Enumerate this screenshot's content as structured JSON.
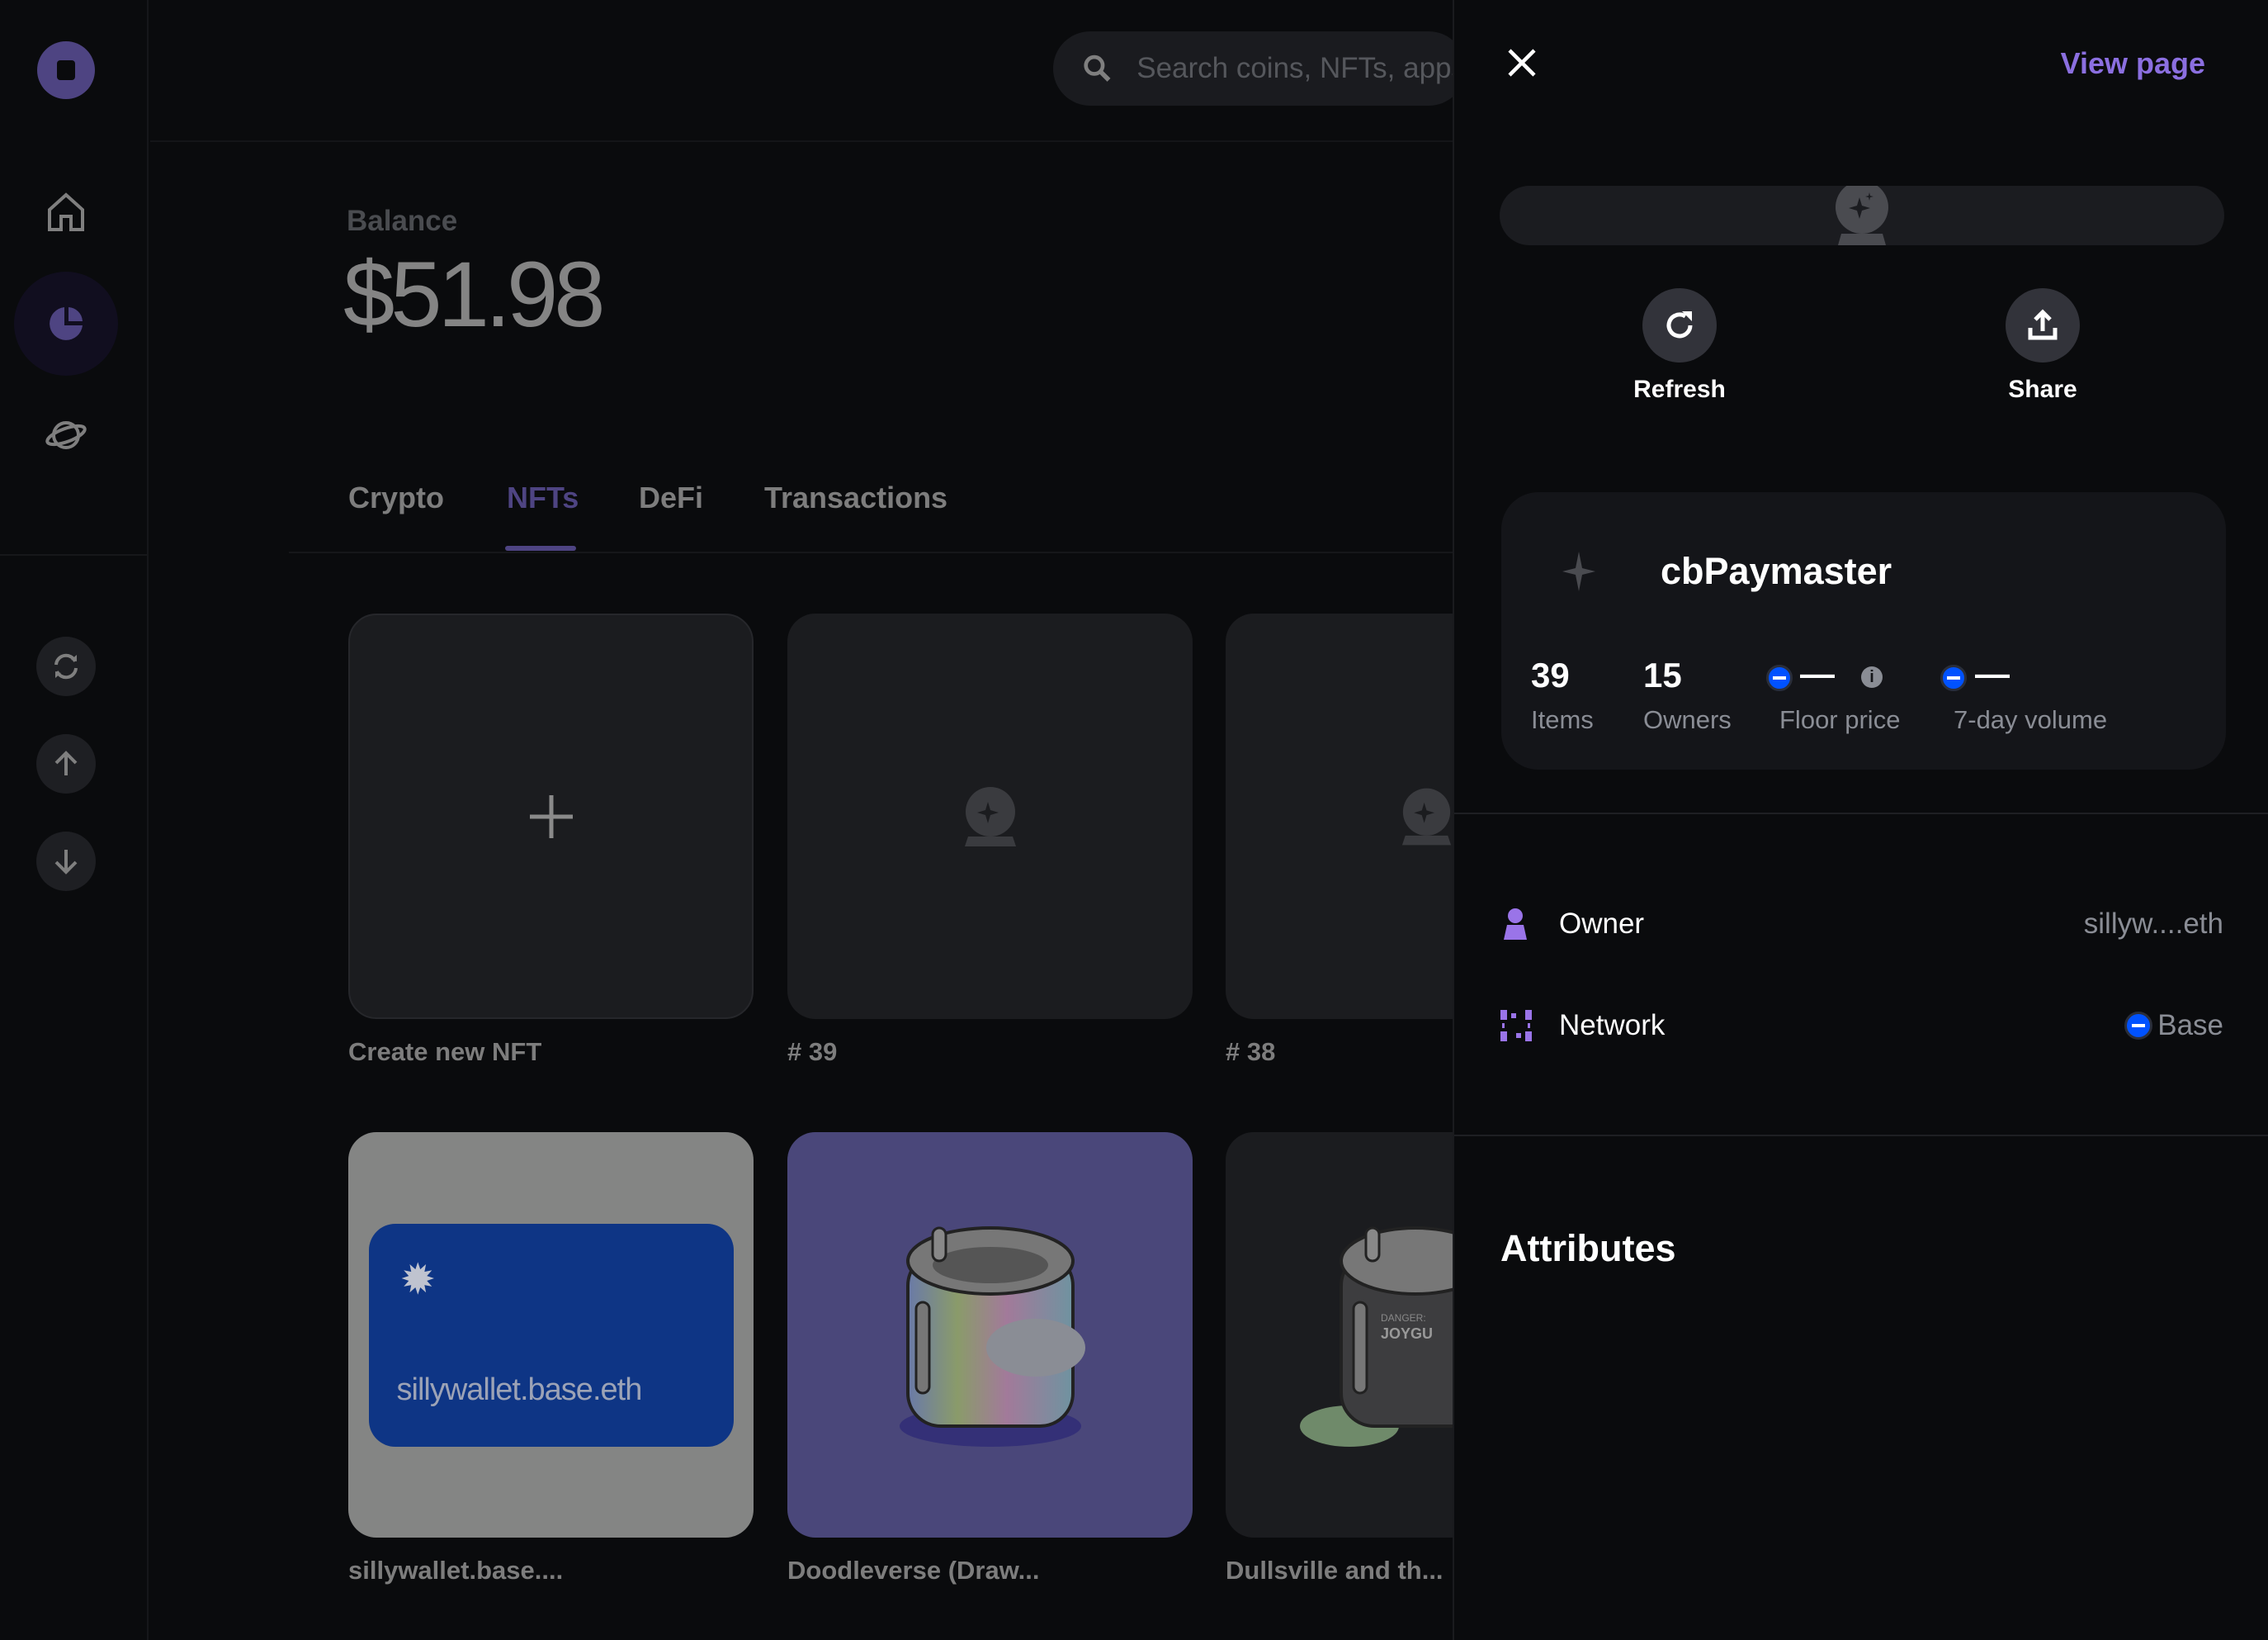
{
  "sidebar": {
    "items": [
      {
        "icon": "logo-icon"
      },
      {
        "icon": "home-icon"
      },
      {
        "icon": "portfolio-pie-icon",
        "active": true
      },
      {
        "icon": "explore-planet-icon"
      },
      {
        "icon": "swap-icon"
      },
      {
        "icon": "send-arrow-up-icon"
      },
      {
        "icon": "receive-arrow-down-icon"
      }
    ]
  },
  "search": {
    "placeholder": "Search coins, NFTs, apps"
  },
  "balance": {
    "label": "Balance",
    "value": "$51.98"
  },
  "tabs": [
    {
      "label": "Crypto"
    },
    {
      "label": "NFTs",
      "active": true
    },
    {
      "label": "DeFi"
    },
    {
      "label": "Transactions"
    }
  ],
  "nfts": [
    {
      "label": "Create new NFT"
    },
    {
      "label": "# 39"
    },
    {
      "label": "# 38"
    },
    {
      "label": "sillywallet.base....",
      "image_text": "sillywallet.base.eth"
    },
    {
      "label": "Doodleverse (Draw..."
    },
    {
      "label": "Dullsville and th...",
      "image_text_1": "DANGER:",
      "image_text_2": "JOYGU"
    }
  ],
  "panel": {
    "view_page": "View page",
    "actions": [
      {
        "label": "Refresh",
        "icon": "refresh-icon"
      },
      {
        "label": "Share",
        "icon": "share-icon"
      }
    ],
    "collection": {
      "name": "cbPaymaster",
      "stats": [
        {
          "value": "39",
          "label": "Items"
        },
        {
          "value": "15",
          "label": "Owners"
        },
        {
          "value": "—",
          "label": "Floor price"
        },
        {
          "value": "—",
          "label": "7-day volume"
        }
      ]
    },
    "details": [
      {
        "label": "Owner",
        "value": "sillyw....eth",
        "icon": "person-icon"
      },
      {
        "label": "Network",
        "value": "Base",
        "icon": "network-icon"
      }
    ],
    "attributes_title": "Attributes"
  },
  "colors": {
    "accent": "#8b6fe0",
    "base_blue": "#0052ff",
    "dim_accent": "#4e4482"
  }
}
